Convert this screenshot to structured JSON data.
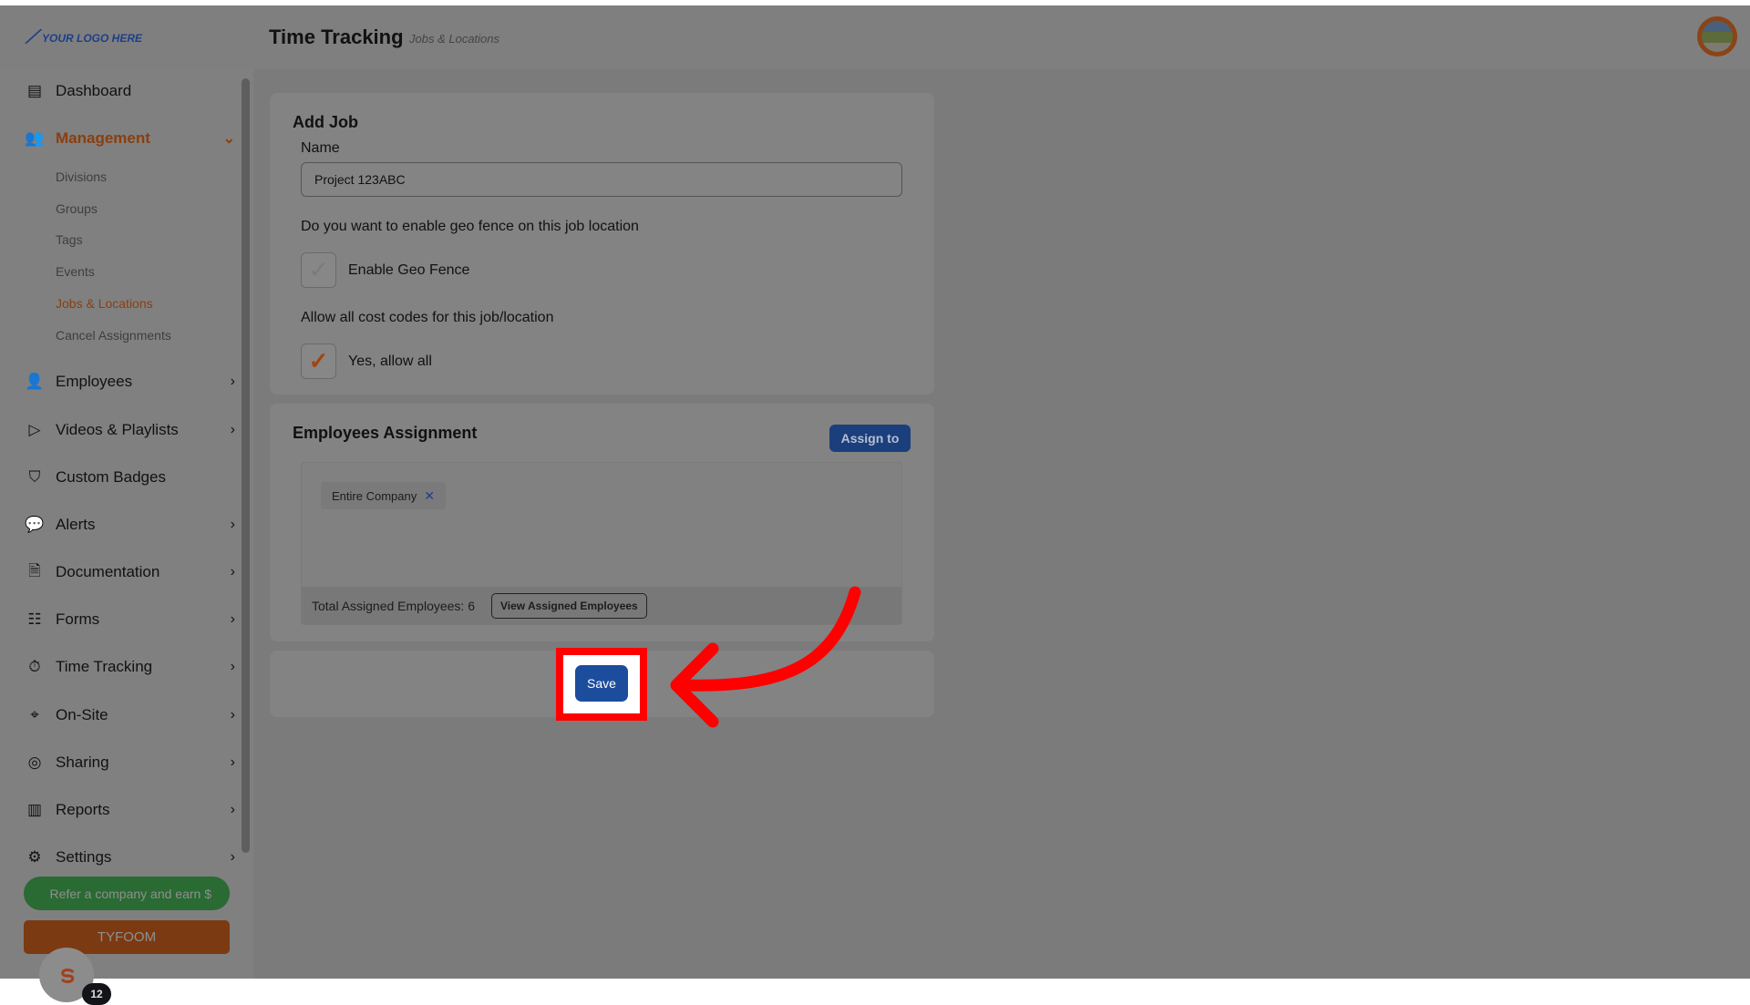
{
  "header": {
    "logo_text": "YOUR LOGO HERE",
    "title": "Time Tracking",
    "subtitle": "Jobs & Locations"
  },
  "sidebar": {
    "items": [
      {
        "label": "Dashboard",
        "icon": "dashboard-icon"
      },
      {
        "label": "Management",
        "icon": "users-icon",
        "active": true
      },
      {
        "label": "Employees",
        "icon": "user-icon"
      },
      {
        "label": "Videos & Playlists",
        "icon": "video-icon"
      },
      {
        "label": "Custom Badges",
        "icon": "badge-icon"
      },
      {
        "label": "Alerts",
        "icon": "chat-bubble-icon"
      },
      {
        "label": "Documentation",
        "icon": "document-check-icon"
      },
      {
        "label": "Forms",
        "icon": "form-list-icon"
      },
      {
        "label": "Time Tracking",
        "icon": "stopwatch-icon"
      },
      {
        "label": "On-Site",
        "icon": "map-pin-icon"
      },
      {
        "label": "Sharing",
        "icon": "share-user-icon"
      },
      {
        "label": "Reports",
        "icon": "bar-chart-icon"
      },
      {
        "label": "Settings",
        "icon": "gear-icon"
      }
    ],
    "subitems": [
      "Divisions",
      "Groups",
      "Tags",
      "Events",
      "Jobs & Locations",
      "Cancel Assignments"
    ],
    "active_subitem": "Jobs & Locations",
    "refer_button": "Refer a company and earn $",
    "brand_button": "TYFOOM",
    "notification_count": "12"
  },
  "add_job": {
    "title": "Add Job",
    "name_label": "Name",
    "name_value": "Project 123ABC",
    "geo_question": "Do you want to enable geo fence on this job location",
    "geo_label": "Enable Geo Fence",
    "geo_checked": false,
    "cost_question": "Allow all cost codes for this job/location",
    "cost_label": "Yes, allow all",
    "cost_checked": true
  },
  "assignment": {
    "title": "Employees Assignment",
    "assign_button": "Assign to",
    "chips": [
      "Entire Company"
    ],
    "total_text": "Total Assigned Employees: 6",
    "view_button": "View Assigned Employees"
  },
  "save_button": "Save",
  "colors": {
    "accent": "#d2691e",
    "primary": "#1c4c9c",
    "highlight": "#ff0000"
  }
}
